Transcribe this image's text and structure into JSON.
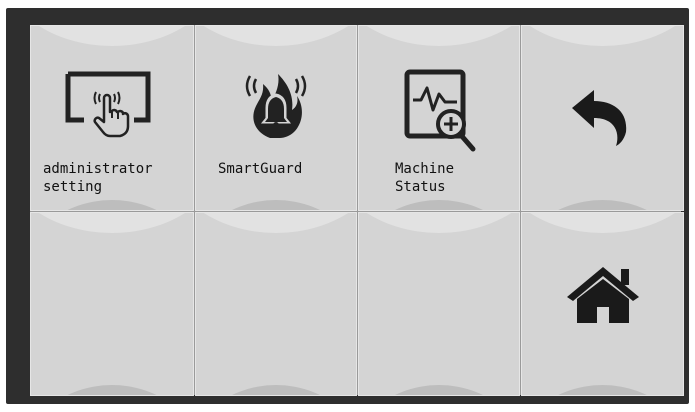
{
  "tiles": [
    {
      "label_line1": "administrator",
      "label_line2": "setting",
      "icon": "touch-screen-icon"
    },
    {
      "label_line1": "SmartGuard",
      "label_line2": "",
      "icon": "flame-alarm-icon"
    },
    {
      "label_line1": "Machine",
      "label_line2": "Status",
      "icon": "monitor-magnifier-icon"
    },
    {
      "label_line1": "",
      "label_line2": "",
      "icon": "back-arrow-icon"
    },
    {
      "label_line1": "",
      "label_line2": "",
      "icon": ""
    },
    {
      "label_line1": "",
      "label_line2": "",
      "icon": ""
    },
    {
      "label_line1": "",
      "label_line2": "",
      "icon": ""
    },
    {
      "label_line1": "",
      "label_line2": "",
      "icon": "home-icon"
    }
  ],
  "colors": {
    "frame": "#2e2e2e",
    "tile": "#d4d4d4",
    "icon": "#222222"
  }
}
